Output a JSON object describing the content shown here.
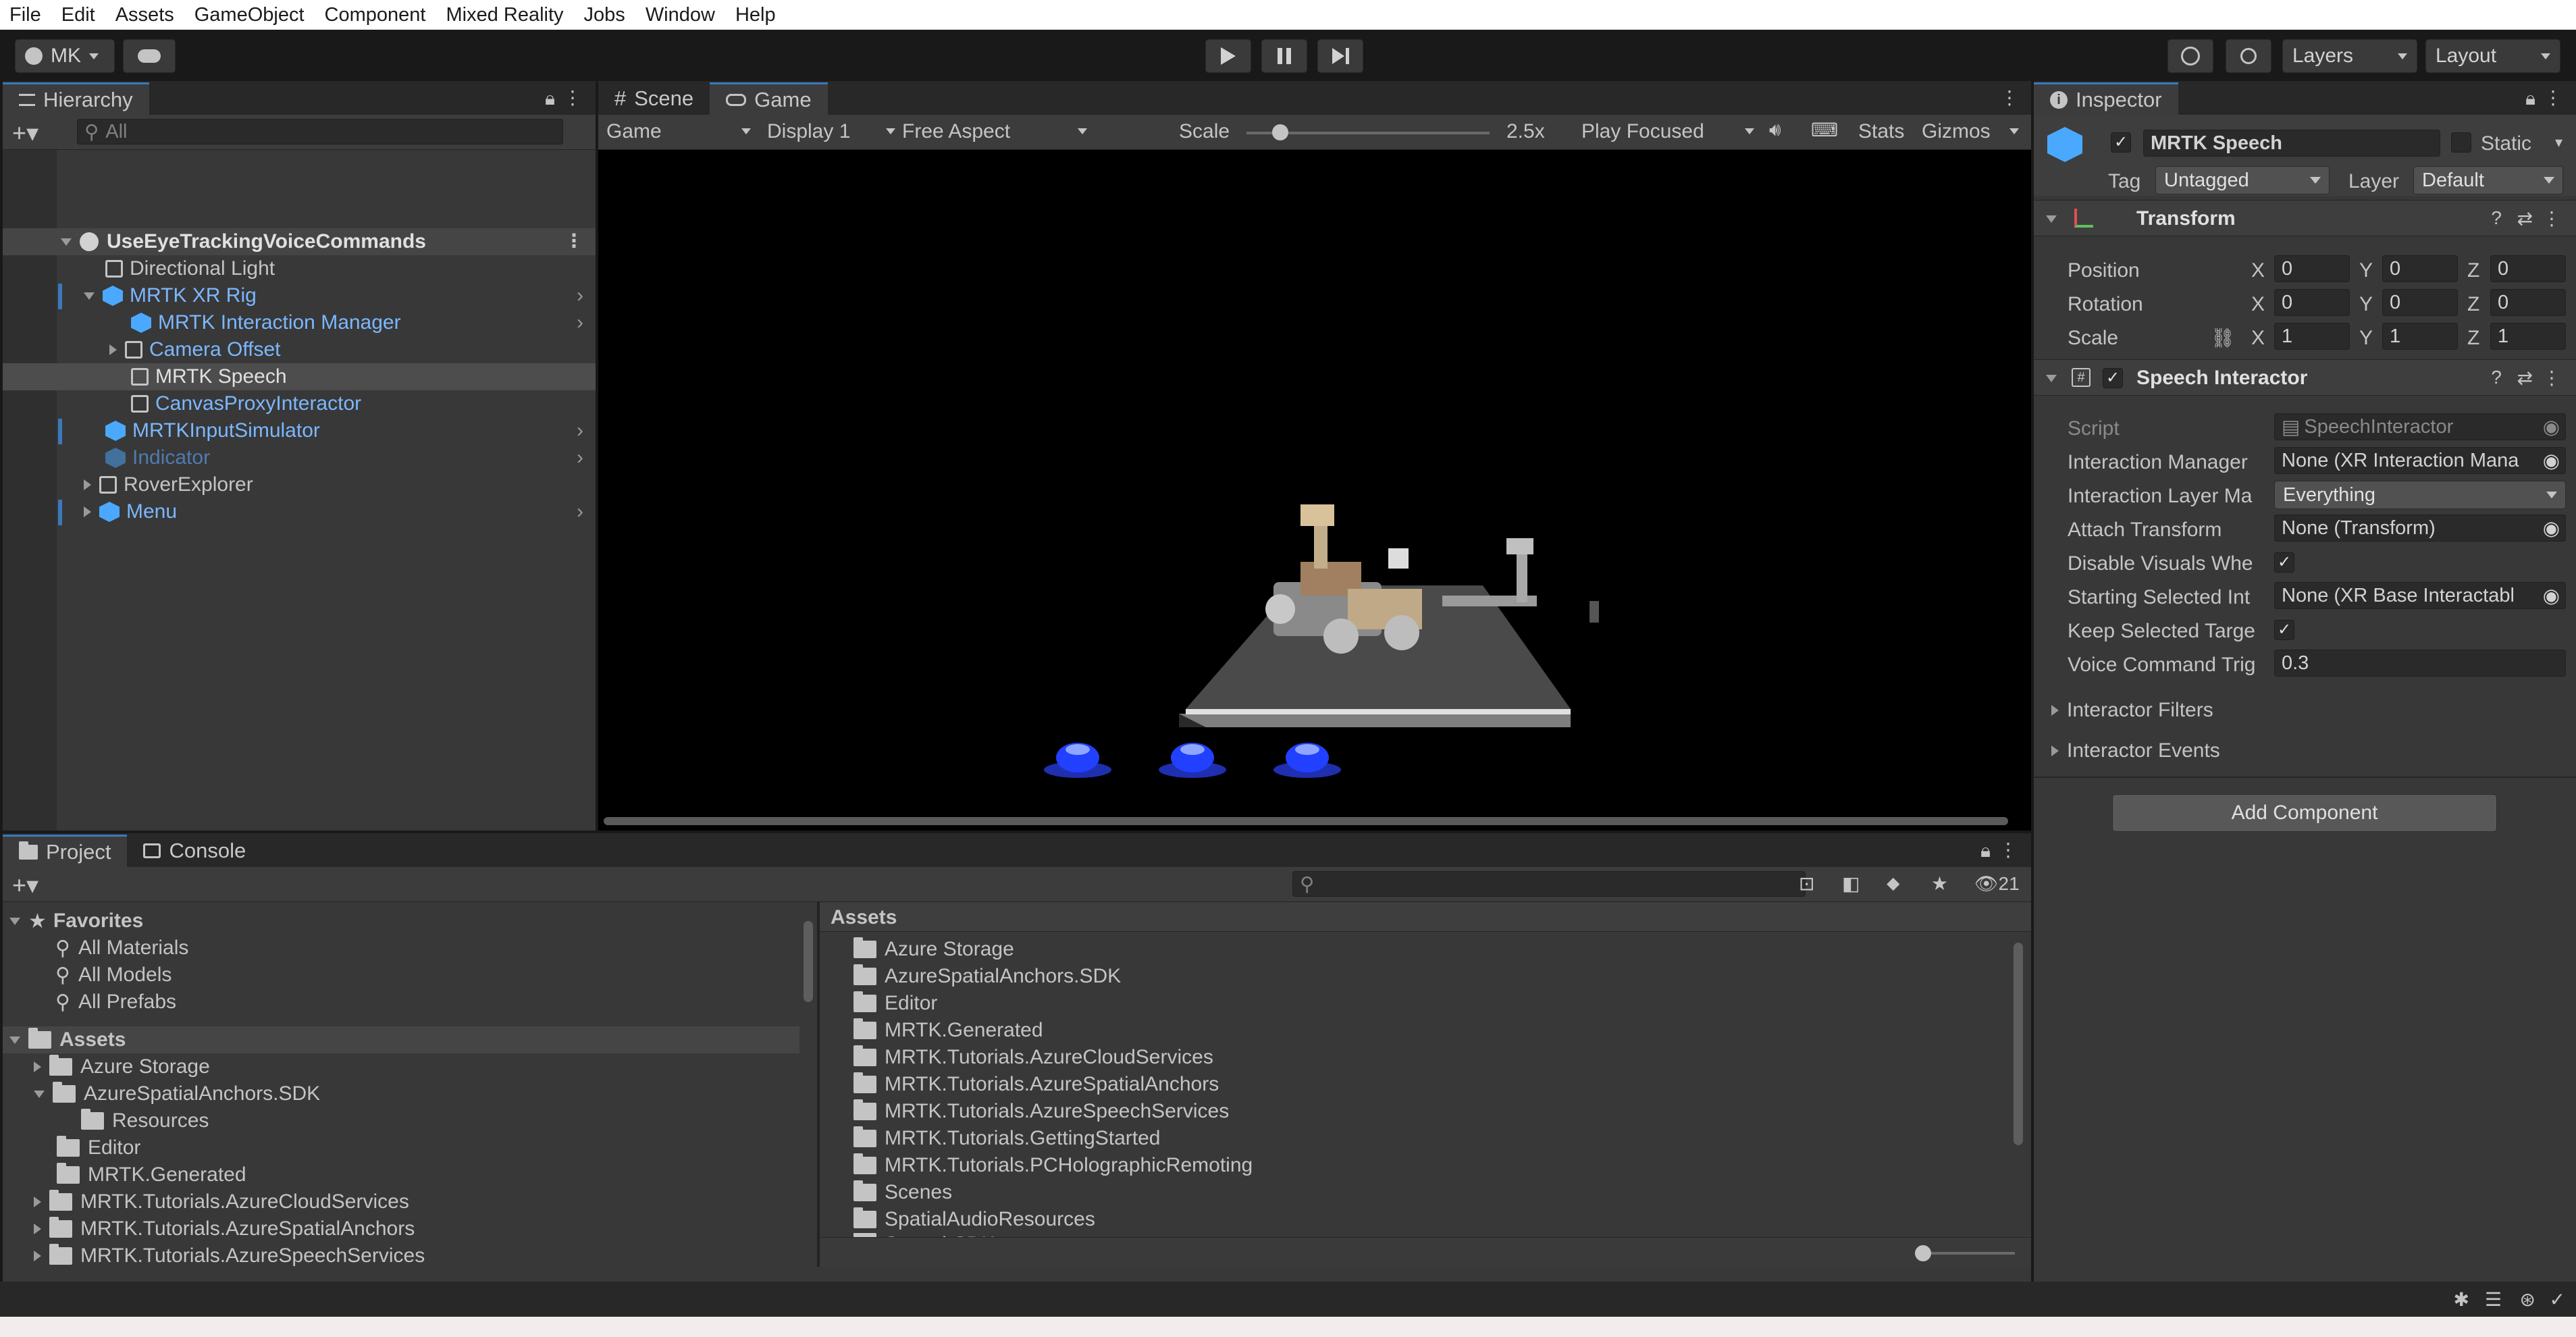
{
  "menu": [
    "File",
    "Edit",
    "Assets",
    "GameObject",
    "Component",
    "Mixed Reality",
    "Jobs",
    "Window",
    "Help"
  ],
  "toolbar": {
    "account": "MK",
    "layers": "Layers",
    "layout": "Layout"
  },
  "hierarchy": {
    "tab": "Hierarchy",
    "search_placeholder": "All",
    "scene": "UseEyeTrackingVoiceCommands",
    "items": [
      {
        "label": "Directional Light"
      },
      {
        "label": "MRTK XR Rig"
      },
      {
        "label": "MRTK Interaction Manager"
      },
      {
        "label": "Camera Offset"
      },
      {
        "label": "MRTK Speech"
      },
      {
        "label": "CanvasProxyInteractor"
      },
      {
        "label": "MRTKInputSimulator"
      },
      {
        "label": "Indicator"
      },
      {
        "label": "RoverExplorer"
      },
      {
        "label": "Menu"
      }
    ]
  },
  "game": {
    "tabs": [
      "Scene",
      "Game"
    ],
    "mode": "Game",
    "display": "Display 1",
    "aspect": "Free Aspect",
    "scale_label": "Scale",
    "scale_value": "2.5x",
    "play": "Play Focused",
    "stats": "Stats",
    "gizmos": "Gizmos"
  },
  "inspector": {
    "tab": "Inspector",
    "object_name": "MRTK Speech",
    "static": "Static",
    "tag_label": "Tag",
    "tag": "Untagged",
    "layer_label": "Layer",
    "layer": "Default",
    "transform": {
      "title": "Transform",
      "position": "Position",
      "rotation": "Rotation",
      "scale": "Scale",
      "x": "X",
      "y": "Y",
      "z": "Z",
      "pos": [
        "0",
        "0",
        "0"
      ],
      "rot": [
        "0",
        "0",
        "0"
      ],
      "scl": [
        "1",
        "1",
        "1"
      ]
    },
    "speech": {
      "title": "Speech Interactor",
      "rows": [
        {
          "label": "Script",
          "value": "SpeechInteractor"
        },
        {
          "label": "Interaction Manager",
          "value": "None (XR Interaction Mana"
        },
        {
          "label": "Interaction Layer Ma",
          "value": "Everything"
        },
        {
          "label": "Attach Transform",
          "value": "None (Transform)"
        },
        {
          "label": "Disable Visuals Whe",
          "value": "✓"
        },
        {
          "label": "Starting Selected Int",
          "value": "None (XR Base Interactabl"
        },
        {
          "label": "Keep Selected Targe",
          "value": "✓"
        },
        {
          "label": "Voice Command Trig",
          "value": "0.3"
        }
      ],
      "filters": "Interactor Filters",
      "events": "Interactor Events"
    },
    "add_component": "Add Component"
  },
  "project": {
    "tabs": [
      "Project",
      "Console"
    ],
    "hidden_count": "21",
    "favorites": "Favorites",
    "fav_items": [
      "All Materials",
      "All Models",
      "All Prefabs"
    ],
    "assets": "Assets",
    "tree": [
      {
        "label": "Azure Storage",
        "indent": 1,
        "arrow": "right"
      },
      {
        "label": "AzureSpatialAnchors.SDK",
        "indent": 1,
        "arrow": "down"
      },
      {
        "label": "Resources",
        "indent": 2,
        "arrow": "none"
      },
      {
        "label": "Editor",
        "indent": 1,
        "arrow": "none"
      },
      {
        "label": "MRTK.Generated",
        "indent": 1,
        "arrow": "none"
      },
      {
        "label": "MRTK.Tutorials.AzureCloudServices",
        "indent": 1,
        "arrow": "right"
      },
      {
        "label": "MRTK.Tutorials.AzureSpatialAnchors",
        "indent": 1,
        "arrow": "right"
      },
      {
        "label": "MRTK.Tutorials.AzureSpeechServices",
        "indent": 1,
        "arrow": "right"
      }
    ],
    "breadcrumb": "Assets",
    "grid": [
      "Azure Storage",
      "AzureSpatialAnchors.SDK",
      "Editor",
      "MRTK.Generated",
      "MRTK.Tutorials.AzureCloudServices",
      "MRTK.Tutorials.AzureSpatialAnchors",
      "MRTK.Tutorials.AzureSpeechServices",
      "MRTK.Tutorials.GettingStarted",
      "MRTK.Tutorials.PCHolographicRemoting",
      "Scenes",
      "SpatialAudioResources",
      "SpeechSDK"
    ]
  }
}
